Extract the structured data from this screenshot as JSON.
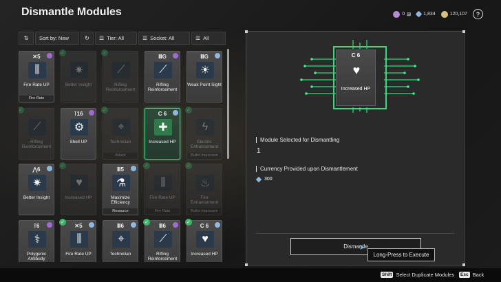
{
  "header": {
    "title": "Dismantle Modules",
    "currencies": [
      {
        "icon": "module-token-icon",
        "value": "0",
        "color": "#b58bd6"
      },
      {
        "icon": "crystal-icon",
        "value": "1,834",
        "color": "#8fb8e0"
      },
      {
        "icon": "gold-coin-icon",
        "value": "120,107",
        "color": "#d9c27a"
      }
    ],
    "help_label": "?"
  },
  "filters": {
    "sort_label": "Sort by: New",
    "tier_label": "Tier: All",
    "socket_label": "Socket: All",
    "all_label": "All"
  },
  "modules": [
    {
      "rank": "✕5",
      "name": "Fire Rate UP",
      "sub": "Fire Rate",
      "icon": "⫼",
      "dim": false,
      "selected": false,
      "check": false,
      "corner": "#a06ad0"
    },
    {
      "rank": "",
      "name": "Better Insight",
      "sub": "",
      "icon": "✷",
      "dim": true,
      "selected": false,
      "check": true,
      "corner": ""
    },
    {
      "rank": "",
      "name": "Rifling Reinforcement",
      "sub": "",
      "icon": "⟋",
      "dim": true,
      "selected": false,
      "check": true,
      "corner": ""
    },
    {
      "rank": "ⅢG",
      "name": "Rifling Reinforcement",
      "sub": "",
      "icon": "⟋",
      "dim": false,
      "selected": false,
      "check": false,
      "corner": "#a06ad0"
    },
    {
      "rank": "ⅢG",
      "name": "Weak Point Sight",
      "sub": "",
      "icon": "☀",
      "dim": false,
      "selected": false,
      "check": false,
      "corner": "#8fb8e0"
    },
    {
      "rank": "",
      "name": "Rifling Reinforcement",
      "sub": "",
      "icon": "⟋",
      "dim": true,
      "selected": false,
      "check": true,
      "corner": ""
    },
    {
      "rank": "⊺16",
      "name": "Shell UP",
      "sub": "",
      "icon": "⚙",
      "dim": false,
      "selected": false,
      "check": false,
      "corner": "#a06ad0"
    },
    {
      "rank": "",
      "name": "Technician",
      "sub": "Attack",
      "icon": "⌖",
      "dim": true,
      "selected": false,
      "check": true,
      "corner": ""
    },
    {
      "rank": "C 6",
      "name": "Increased HP",
      "sub": "",
      "icon": "✚",
      "dim": false,
      "selected": true,
      "check": false,
      "corner": "#8fb8e0"
    },
    {
      "rank": "",
      "name": "Electric Enhancement",
      "sub": "Bullet Improvem",
      "icon": "ϟ",
      "dim": true,
      "selected": false,
      "check": true,
      "corner": ""
    },
    {
      "rank": "⋀6",
      "name": "Better Insight",
      "sub": "",
      "icon": "✷",
      "dim": false,
      "selected": false,
      "check": false,
      "corner": "#8fb8e0"
    },
    {
      "rank": "",
      "name": "Increased HP",
      "sub": "",
      "icon": "♥",
      "dim": true,
      "selected": false,
      "check": true,
      "corner": ""
    },
    {
      "rank": "Ⅲ5",
      "name": "Maximize Efficiency",
      "sub": "Resource",
      "icon": "⚗",
      "dim": false,
      "selected": false,
      "check": false,
      "corner": "#8fb8e0"
    },
    {
      "rank": "",
      "name": "Fire Rate UP",
      "sub": "Fire Rate",
      "icon": "⫼",
      "dim": true,
      "selected": false,
      "check": true,
      "corner": ""
    },
    {
      "rank": "",
      "name": "Fire Enhancement",
      "sub": "Bullet Improvem",
      "icon": "♨",
      "dim": true,
      "selected": false,
      "check": true,
      "corner": ""
    },
    {
      "rank": "⊺6",
      "name": "Polygenic Antibody",
      "sub": "",
      "icon": "⚕",
      "dim": false,
      "selected": false,
      "check": false,
      "corner": "#a06ad0"
    },
    {
      "rank": "✕5",
      "name": "Fire Rate UP",
      "sub": "",
      "icon": "⫼",
      "dim": false,
      "selected": false,
      "check": true,
      "corner": "#8fb8e0"
    },
    {
      "rank": "Ⅲ6",
      "name": "Technician",
      "sub": "",
      "icon": "⌖",
      "dim": false,
      "selected": false,
      "check": false,
      "corner": "#8fb8e0"
    },
    {
      "rank": "Ⅲ6",
      "name": "Rifling Reinforcement",
      "sub": "",
      "icon": "⟋",
      "dim": false,
      "selected": false,
      "check": true,
      "corner": "#a06ad0"
    },
    {
      "rank": "C 6",
      "name": "Increased HP",
      "sub": "",
      "icon": "♥",
      "dim": false,
      "selected": false,
      "check": true,
      "corner": "#8fb8e0"
    }
  ],
  "detail": {
    "card_rank": "C 6",
    "card_name": "Increased HP",
    "card_icon": "♥",
    "selected_title": "Module Selected for Dismantling",
    "selected_count": "1",
    "currency_title": "Currency Provided upon Dismantlement",
    "currency_amount": "300",
    "dismantle_label": "Dismantle",
    "tooltip": "Long-Press to Execute"
  },
  "footer": {
    "shift_key": "Shift",
    "shift_label": "Select Duplicate Modules",
    "esc_key": "Esc",
    "esc_label": "Back"
  }
}
